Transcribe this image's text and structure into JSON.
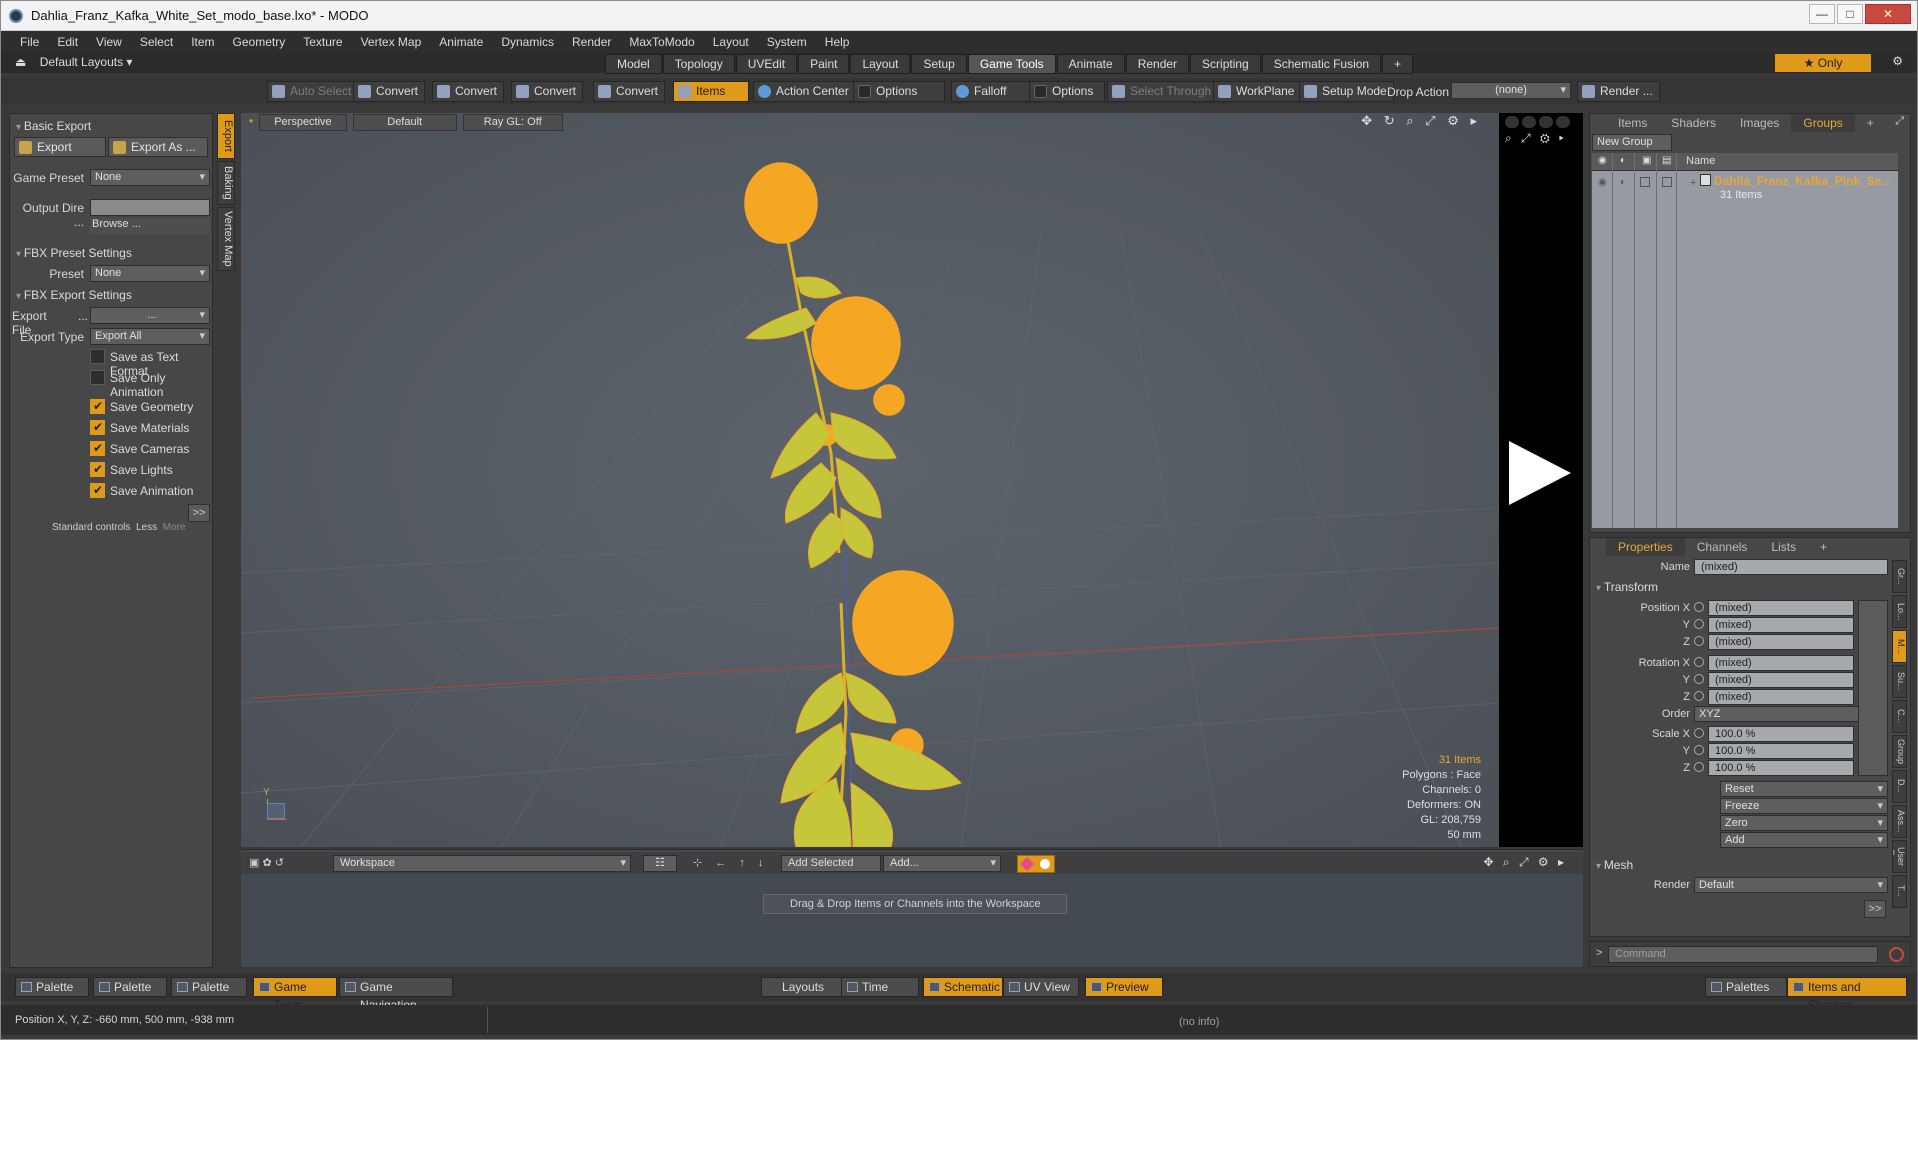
{
  "window": {
    "title": "Dahlia_Franz_Kafka_White_Set_modo_base.lxo* - MODO",
    "controls": {
      "minimize": "—",
      "maximize": "□",
      "close": "✕"
    }
  },
  "menu": [
    "File",
    "Edit",
    "View",
    "Select",
    "Item",
    "Geometry",
    "Texture",
    "Vertex Map",
    "Animate",
    "Dynamics",
    "Render",
    "MaxToModo",
    "Layout",
    "System",
    "Help"
  ],
  "layout_selector": "Default Layouts",
  "layout_tabs": [
    {
      "label": "Model",
      "active": false
    },
    {
      "label": "Topology",
      "active": false
    },
    {
      "label": "UVEdit",
      "active": false
    },
    {
      "label": "Paint",
      "active": false
    },
    {
      "label": "Layout",
      "active": false
    },
    {
      "label": "Setup",
      "active": false
    },
    {
      "label": "Game Tools",
      "active": true
    },
    {
      "label": "Animate",
      "active": false
    },
    {
      "label": "Render",
      "active": false
    },
    {
      "label": "Scripting",
      "active": false
    },
    {
      "label": "Schematic Fusion",
      "active": false
    }
  ],
  "layout_add": "+",
  "only_label": "★ Only",
  "gear_symbol": "⚙",
  "toolbar": {
    "auto_select": "Auto Select",
    "convert": "Convert",
    "items": "Items",
    "action_center": "Action Center",
    "options": "Options",
    "falloff": "Falloff",
    "select_through": "Select Through",
    "workplane": "WorkPlane",
    "setup_mode": "Setup Mode",
    "drop_action": "Drop Action",
    "drop_value": "(none)",
    "render": "Render ..."
  },
  "left_panel": {
    "side_tabs": [
      "Export",
      "Baking",
      "Vertex Map"
    ],
    "basic_export": "Basic Export",
    "export_btn": "Export",
    "export_as_btn": "Export As ...",
    "game_preset_label": "Game Preset",
    "game_preset_value": "None",
    "output_dir_label": "Output Dire ...",
    "browse": "Browse ...",
    "fbx_preset_settings": "FBX Preset Settings",
    "preset_label": "Preset",
    "preset_value": "None",
    "fbx_export_settings": "FBX Export Settings",
    "export_file_label": "Export File",
    "export_file_dots": "...",
    "export_file_value": "...",
    "export_type_label": "Export Type",
    "export_type_value": "Export All",
    "checks": [
      {
        "label": "Save as Text Format",
        "checked": false
      },
      {
        "label": "Save Only Animation",
        "checked": false
      },
      {
        "label": "Save Geometry",
        "checked": true
      },
      {
        "label": "Save Materials",
        "checked": true
      },
      {
        "label": "Save Cameras",
        "checked": true
      },
      {
        "label": "Save Lights",
        "checked": true
      },
      {
        "label": "Save Animation",
        "checked": true
      }
    ],
    "more_btn": ">>",
    "standard_controls": "Standard controls",
    "less": "Less",
    "more": "More"
  },
  "viewport": {
    "tabs": [
      "Perspective",
      "Default",
      "Ray GL: Off"
    ],
    "icons": "✥ ↻ ⌕ ⤢ ⚙ ▸",
    "stats": {
      "items": "31 Items",
      "polygons": "Polygons : Face",
      "channels": "Channels: 0",
      "deformers": "Deformers: ON",
      "gl": "GL: 208,759",
      "scale": "50 mm"
    },
    "axis_y": "Y"
  },
  "preview": {
    "icons": "⌕ ⤢ ⚙ ▸"
  },
  "right_top": {
    "tabs": [
      {
        "label": "Items",
        "active": false
      },
      {
        "label": "Shaders",
        "active": false
      },
      {
        "label": "Images",
        "active": false
      },
      {
        "label": "Groups",
        "active": true
      }
    ],
    "add": "+",
    "new_group": "New Group",
    "col_name": "Name",
    "group_name": "Dahlia_Franz_Kafka_Pink_Se...",
    "group_count": "31 Items"
  },
  "properties": {
    "tabs": [
      {
        "label": "Properties",
        "active": true
      },
      {
        "label": "Channels",
        "active": false
      },
      {
        "label": "Lists",
        "active": false
      }
    ],
    "add": "+",
    "name_label": "Name",
    "name_value": "(mixed)",
    "transform": "Transform",
    "position_x_label": "Position X",
    "rotation_x_label": "Rotation X",
    "scale_x_label": "Scale X",
    "y_label": "Y",
    "z_label": "Z",
    "position": [
      "(mixed)",
      "(mixed)",
      "(mixed)"
    ],
    "rotation": [
      "(mixed)",
      "(mixed)",
      "(mixed)"
    ],
    "order_label": "Order",
    "order_value": "XYZ",
    "scale": [
      "100.0 %",
      "100.0 %",
      "100.0 %"
    ],
    "actions": [
      "Reset",
      "Freeze",
      "Zero",
      "Add"
    ],
    "mesh": "Mesh",
    "render_label": "Render",
    "render_value": "Default",
    "more_btn": ">>",
    "side_tabs": [
      "Gr...",
      "Lo...",
      "M...",
      "Su...",
      "C...",
      "Group ...",
      "D...",
      "Ass...",
      "User C...",
      "T..."
    ]
  },
  "command": {
    "placeholder": "Command",
    "prompt": ">"
  },
  "workspace": {
    "dropdown": "Workspace",
    "add_selected": "Add Selected",
    "add": "Add...",
    "hint": "Drag & Drop Items or Channels into the Workspace"
  },
  "bottom_bar": {
    "palette1": "Palette",
    "palette2": "Palette",
    "palette3": "Palette",
    "game_tools": "Game Tools",
    "game_navigation": "Game Navigation",
    "layouts": "Layouts",
    "time": "Time",
    "schematic": "Schematic",
    "uv_view": "UV View",
    "preview": "Preview",
    "palettes": "Palettes",
    "items_and_shading": "Items and Shading"
  },
  "status": {
    "position": "Position X, Y, Z:  -660 mm, 500 mm, -938 mm",
    "info": "(no info)"
  },
  "colors": {
    "accent": "#e09a1a",
    "flower": "#f5a623",
    "leaf": "#c9c83a"
  }
}
